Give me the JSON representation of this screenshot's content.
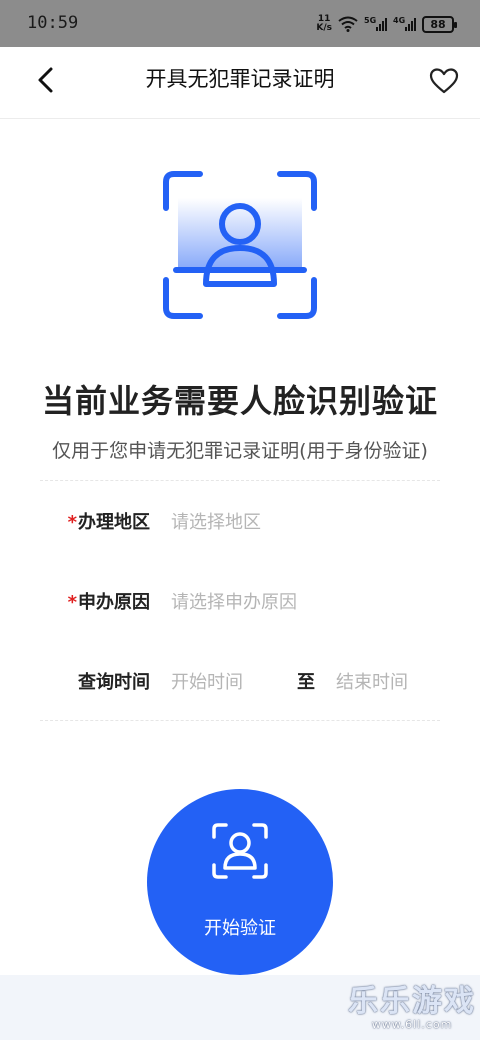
{
  "status_bar": {
    "time": "10:59",
    "net_speed_value": "11",
    "net_speed_unit": "K/s",
    "signal1_tag": "5G",
    "signal2_tag": "4G",
    "battery": "88"
  },
  "nav": {
    "title": "开具无犯罪记录证明",
    "back_icon": "chevron-left-icon",
    "favorite_icon": "heart-icon"
  },
  "hero": {
    "title": "当前业务需要人脸识别验证",
    "subtitle": "仅用于您申请无犯罪记录证明(用于身份验证)"
  },
  "form": {
    "region": {
      "required_mark": "*",
      "label": "办理地区",
      "placeholder": "请选择地区"
    },
    "reason": {
      "required_mark": "*",
      "label": "申办原因",
      "placeholder": "请选择申办原因"
    },
    "time": {
      "label": "查询时间",
      "start_placeholder": "开始时间",
      "separator": "至",
      "end_placeholder": "结束时间"
    }
  },
  "verify_button": {
    "label": "开始验证",
    "icon": "face-scan-icon"
  },
  "watermark": {
    "main": "乐乐游戏",
    "sub": "www.6ll.com"
  },
  "colors": {
    "accent": "#2361f5",
    "required": "#e02020",
    "placeholder": "#b5b5b5"
  }
}
